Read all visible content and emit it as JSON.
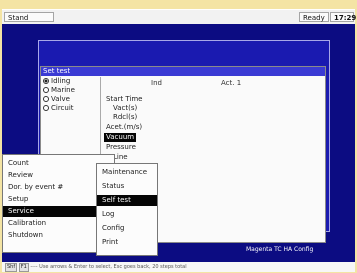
{
  "top_bar": {
    "mode": "Stand",
    "ready": "Ready",
    "time": "17:29"
  },
  "dialog": {
    "title": "Set test",
    "radio_options": [
      {
        "label": "Idling",
        "selected": true
      },
      {
        "label": "Marine",
        "selected": false
      },
      {
        "label": "Valve",
        "selected": false
      },
      {
        "label": "Circuit",
        "selected": false
      }
    ],
    "column_headers": {
      "left": "Ind",
      "right": "Act. 1"
    },
    "list_rows": [
      "Start Time",
      "Vact(s)",
      "Rdcl(s)",
      "Acet.(m/s)",
      "Vacuum",
      "Pressure",
      "Line"
    ],
    "selected_row": 4
  },
  "main_menu": {
    "items": [
      "Count",
      "Review",
      "Dor. by event #",
      "Setup",
      "Service",
      "Calibration",
      "Shutdown"
    ],
    "selected": 4,
    "has_arrow": [
      false,
      false,
      true,
      true,
      true,
      true,
      false
    ]
  },
  "sub_menu": {
    "items": [
      "Maintenance",
      "Status",
      "Self test",
      "Log",
      "Config",
      "Print"
    ],
    "selected": 2
  },
  "footer_note": "Magenta TC   HA Config",
  "help_bar": {
    "key_labels": [
      "Shf",
      "F1"
    ],
    "hint": "---- Use arrows & Enter to select, Esc goes back, 20 steps total"
  },
  "colors": {
    "background": "#f4e4a4",
    "workspace": "#0c0c82",
    "panel": "#1a1ab0",
    "dialog_title": "#3a3ad4",
    "selection": "#050505"
  }
}
